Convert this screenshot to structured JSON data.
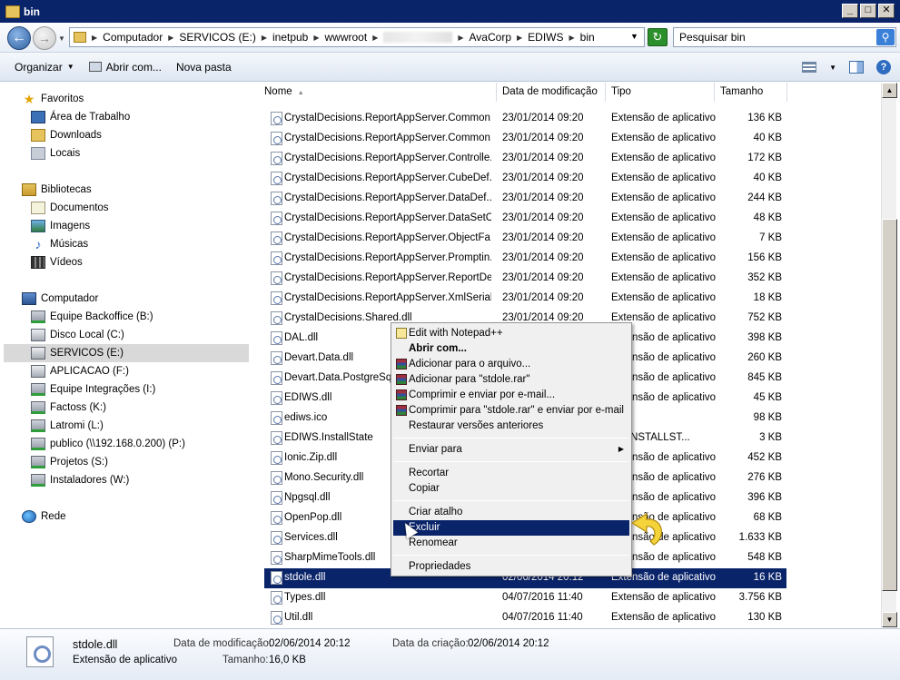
{
  "window": {
    "title": "bin",
    "min": "_",
    "max": "□",
    "close": "✕"
  },
  "address": {
    "crumbs": [
      "Computador",
      "SERVICOS (E:)",
      "inetpub",
      "wwwroot",
      "AvaCorp",
      "EDIWS",
      "bin"
    ],
    "search_placeholder": "Pesquisar bin"
  },
  "toolbar": {
    "organize": "Organizar",
    "open_with": "Abrir com...",
    "new_folder": "Nova pasta"
  },
  "nav": {
    "favorites": "Favoritos",
    "fav_items": [
      "Área de Trabalho",
      "Downloads",
      "Locais"
    ],
    "libraries": "Bibliotecas",
    "lib_items": [
      "Documentos",
      "Imagens",
      "Músicas",
      "Vídeos"
    ],
    "computer": "Computador",
    "drives": [
      "Equipe Backoffice (B:)",
      "Disco Local (C:)",
      "SERVICOS (E:)",
      "APLICACAO (F:)",
      "Equipe Integrações (I:)",
      "Factoss (K:)",
      "Latromi (L:)",
      "publico (\\\\192.168.0.200) (P:)",
      "Projetos (S:)",
      "Instaladores (W:)"
    ],
    "network": "Rede"
  },
  "columns": {
    "name": "Nome",
    "date": "Data de modificação",
    "type": "Tipo",
    "size": "Tamanho"
  },
  "files": [
    {
      "name": "CrystalDecisions.ReportAppServer.Common...",
      "date": "23/01/2014 09:20",
      "type": "Extensão de aplicativo",
      "size": "136 KB"
    },
    {
      "name": "CrystalDecisions.ReportAppServer.Common...",
      "date": "23/01/2014 09:20",
      "type": "Extensão de aplicativo",
      "size": "40 KB"
    },
    {
      "name": "CrystalDecisions.ReportAppServer.Controlle...",
      "date": "23/01/2014 09:20",
      "type": "Extensão de aplicativo",
      "size": "172 KB"
    },
    {
      "name": "CrystalDecisions.ReportAppServer.CubeDef...",
      "date": "23/01/2014 09:20",
      "type": "Extensão de aplicativo",
      "size": "40 KB"
    },
    {
      "name": "CrystalDecisions.ReportAppServer.DataDef...",
      "date": "23/01/2014 09:20",
      "type": "Extensão de aplicativo",
      "size": "244 KB"
    },
    {
      "name": "CrystalDecisions.ReportAppServer.DataSetC...",
      "date": "23/01/2014 09:20",
      "type": "Extensão de aplicativo",
      "size": "48 KB"
    },
    {
      "name": "CrystalDecisions.ReportAppServer.ObjectFa...",
      "date": "23/01/2014 09:20",
      "type": "Extensão de aplicativo",
      "size": "7 KB"
    },
    {
      "name": "CrystalDecisions.ReportAppServer.Promptin...",
      "date": "23/01/2014 09:20",
      "type": "Extensão de aplicativo",
      "size": "156 KB"
    },
    {
      "name": "CrystalDecisions.ReportAppServer.ReportDe...",
      "date": "23/01/2014 09:20",
      "type": "Extensão de aplicativo",
      "size": "352 KB"
    },
    {
      "name": "CrystalDecisions.ReportAppServer.XmlSeriali...",
      "date": "23/01/2014 09:20",
      "type": "Extensão de aplicativo",
      "size": "18 KB"
    },
    {
      "name": "CrystalDecisions.Shared.dll",
      "date": "23/01/2014 09:20",
      "type": "Extensão de aplicativo",
      "size": "752 KB"
    },
    {
      "name": "DAL.dll",
      "date": "",
      "type": "Extensão de aplicativo",
      "size": "398 KB"
    },
    {
      "name": "Devart.Data.dll",
      "date": "",
      "type": "Extensão de aplicativo",
      "size": "260 KB"
    },
    {
      "name": "Devart.Data.PostgreSql",
      "date": "",
      "type": "Extensão de aplicativo",
      "size": "845 KB"
    },
    {
      "name": "EDIWS.dll",
      "date": "",
      "type": "Extensão de aplicativo",
      "size": "45 KB"
    },
    {
      "name": "ediws.ico",
      "date": "",
      "type": "e",
      "size": "98 KB"
    },
    {
      "name": "EDIWS.InstallState",
      "date": "",
      "type": "ivo INSTALLST...",
      "size": "3 KB"
    },
    {
      "name": "Ionic.Zip.dll",
      "date": "",
      "type": "Extensão de aplicativo",
      "size": "452 KB"
    },
    {
      "name": "Mono.Security.dll",
      "date": "",
      "type": "Extensão de aplicativo",
      "size": "276 KB"
    },
    {
      "name": "Npgsql.dll",
      "date": "",
      "type": "Extensão de aplicativo",
      "size": "396 KB"
    },
    {
      "name": "OpenPop.dll",
      "date": "",
      "type": "Extensão de aplicativo",
      "size": "68 KB"
    },
    {
      "name": "Services.dll",
      "date": "",
      "type": "Extensão de aplicativo",
      "size": "1.633 KB"
    },
    {
      "name": "SharpMimeTools.dll",
      "date": "",
      "type": "Extensão de aplicativo",
      "size": "548 KB"
    },
    {
      "name": "stdole.dll",
      "date": "02/06/2014 20:12",
      "type": "Extensão de aplicativo",
      "size": "16 KB"
    },
    {
      "name": "Types.dll",
      "date": "04/07/2016 11:40",
      "type": "Extensão de aplicativo",
      "size": "3.756 KB"
    },
    {
      "name": "Util.dll",
      "date": "04/07/2016 11:40",
      "type": "Extensão de aplicativo",
      "size": "130 KB"
    }
  ],
  "context_menu": {
    "edit_notepad": "Edit with Notepad++",
    "open_with": "Abrir com...",
    "add_archive": "Adicionar para o arquivo...",
    "add_rar": "Adicionar para \"stdole.rar\"",
    "compress_email": "Comprimir e enviar por e-mail...",
    "compress_rar_email": "Comprimir para \"stdole.rar\" e enviar por e-mail",
    "restore": "Restaurar versões anteriores",
    "send_to": "Enviar para",
    "cut": "Recortar",
    "copy": "Copiar",
    "create_shortcut": "Criar atalho",
    "delete": "Excluir",
    "rename": "Renomear",
    "properties": "Propriedades"
  },
  "details": {
    "filename": "stdole.dll",
    "filetype": "Extensão de aplicativo",
    "mod_label": "Data de modificação:",
    "mod_value": "02/06/2014 20:12",
    "created_label": "Data da criação:",
    "created_value": "02/06/2014 20:12",
    "size_label": "Tamanho:",
    "size_value": "16,0 KB"
  }
}
